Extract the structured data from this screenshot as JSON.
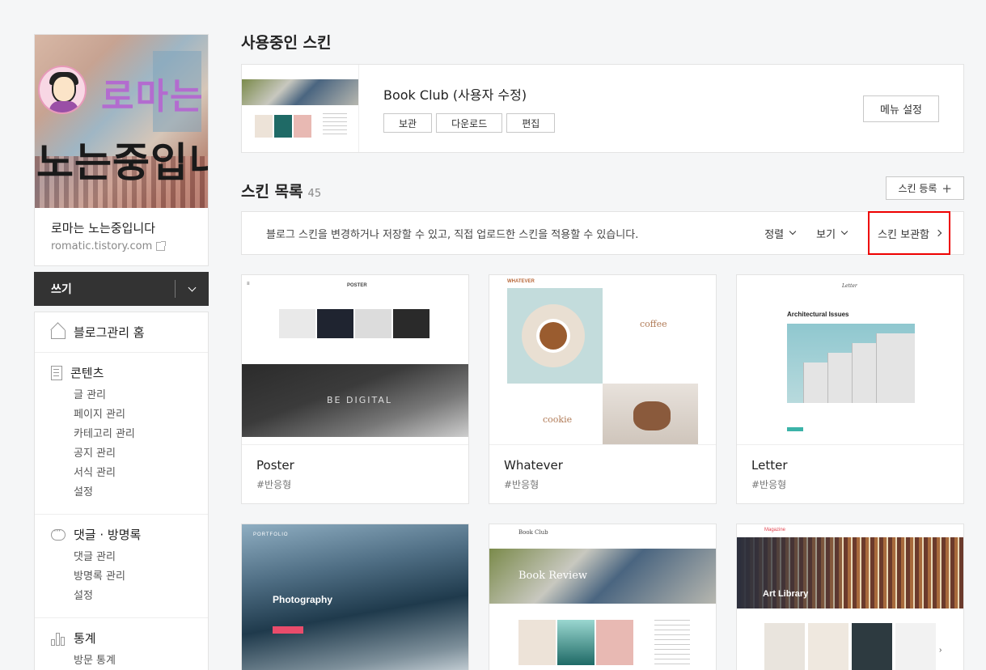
{
  "profile": {
    "cover_title_line1": "로마는",
    "cover_title_line2": "노는중입니다",
    "blog_name": "로마는 노는중입니다",
    "blog_url": "romatic.tistory.com"
  },
  "write": {
    "label": "쓰기"
  },
  "menu": {
    "home": "블로그관리 홈",
    "content": {
      "title": "콘텐츠",
      "items": [
        "글 관리",
        "페이지 관리",
        "카테고리 관리",
        "공지 관리",
        "서식 관리",
        "설정"
      ]
    },
    "comments": {
      "title": "댓글 · 방명록",
      "items": [
        "댓글 관리",
        "방명록 관리",
        "설정"
      ]
    },
    "stats": {
      "title": "통계",
      "items": [
        "방문 통계"
      ]
    }
  },
  "current_skin": {
    "heading": "사용중인 스킨",
    "name": "Book Club (사용자 수정)",
    "buttons": [
      "보관",
      "다운로드",
      "편집"
    ],
    "menu_settings": "메뉴 설정"
  },
  "skin_list": {
    "heading": "스킨 목록",
    "count": "45",
    "register": "스킨 등록",
    "notice": "블로그 스킨을 변경하거나 저장할 수 있고, 직접 업로드한 스킨을 적용할 수 있습니다.",
    "sort": "정렬",
    "view": "보기",
    "vault": "스킨 보관함"
  },
  "skins": [
    {
      "name": "Poster",
      "tag": "#반응형",
      "thumb_text": "BE DIGITAL",
      "thumb_brand": "POSTER"
    },
    {
      "name": "Whatever",
      "tag": "#반응형",
      "thumb_text": "coffee",
      "thumb_text2": "cookie",
      "thumb_brand": "WHATEVER"
    },
    {
      "name": "Letter",
      "tag": "#반응형",
      "thumb_text": "Architectural Issues",
      "thumb_brand": "Letter"
    },
    {
      "thumb_text": "Photography",
      "thumb_brand": "PORTFOLIO"
    },
    {
      "thumb_text": "Book Review",
      "thumb_brand": "Book Club"
    },
    {
      "thumb_text": "Art Library",
      "thumb_brand": "Magazine"
    }
  ]
}
